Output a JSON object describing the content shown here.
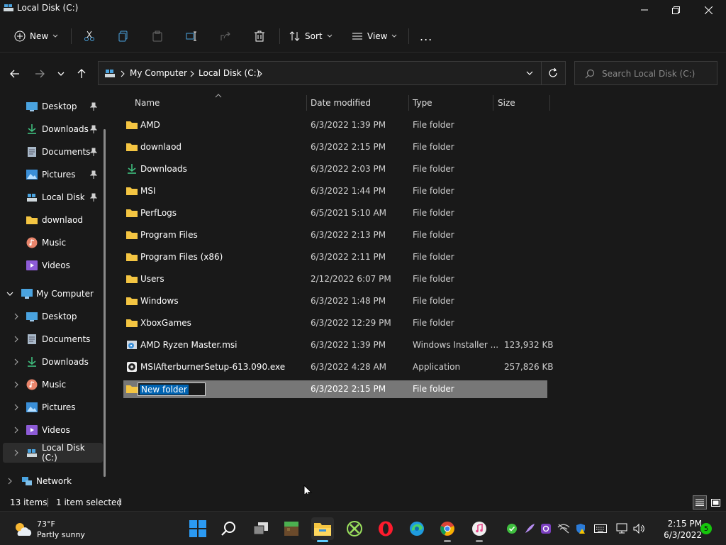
{
  "window": {
    "title": "Local Disk (C:)"
  },
  "toolbar": {
    "new_label": "New",
    "sort_label": "Sort",
    "view_label": "View",
    "more_label": "..."
  },
  "address": {
    "crumbs": [
      "My Computer",
      "Local Disk (C:)"
    ]
  },
  "search": {
    "placeholder": "Search Local Disk (C:)"
  },
  "nav": {
    "quick_access": [
      {
        "label": "Desktop",
        "icon": "desktop-icon",
        "pinned": true
      },
      {
        "label": "Downloads",
        "icon": "download-icon",
        "pinned": true
      },
      {
        "label": "Documents",
        "icon": "document-icon",
        "pinned": true
      },
      {
        "label": "Pictures",
        "icon": "picture-icon",
        "pinned": true
      },
      {
        "label": "Local Disk (C:)",
        "icon": "drive-icon",
        "pinned": true
      },
      {
        "label": "downlaod",
        "icon": "folder-icon",
        "pinned": false
      },
      {
        "label": "Music",
        "icon": "music-icon",
        "pinned": false
      },
      {
        "label": "Videos",
        "icon": "video-icon",
        "pinned": false
      }
    ],
    "this_pc": {
      "label": "My Computer",
      "children": [
        {
          "label": "Desktop",
          "icon": "desktop-icon"
        },
        {
          "label": "Documents",
          "icon": "document-icon"
        },
        {
          "label": "Downloads",
          "icon": "download-icon"
        },
        {
          "label": "Music",
          "icon": "music-icon"
        },
        {
          "label": "Pictures",
          "icon": "picture-icon"
        },
        {
          "label": "Videos",
          "icon": "video-icon"
        },
        {
          "label": "Local Disk (C:)",
          "icon": "drive-icon",
          "selected": true
        }
      ]
    },
    "network": {
      "label": "Network"
    }
  },
  "columns": {
    "name": "Name",
    "date": "Date modified",
    "type": "Type",
    "size": "Size"
  },
  "files": [
    {
      "name": "AMD",
      "date": "6/3/2022 1:39 PM",
      "type": "File folder",
      "size": "",
      "icon": "folder-icon"
    },
    {
      "name": "downlaod",
      "date": "6/3/2022 2:15 PM",
      "type": "File folder",
      "size": "",
      "icon": "folder-icon"
    },
    {
      "name": "Downloads",
      "date": "6/3/2022 2:03 PM",
      "type": "File folder",
      "size": "",
      "icon": "download-icon"
    },
    {
      "name": "MSI",
      "date": "6/3/2022 1:44 PM",
      "type": "File folder",
      "size": "",
      "icon": "folder-icon"
    },
    {
      "name": "PerfLogs",
      "date": "6/5/2021 5:10 AM",
      "type": "File folder",
      "size": "",
      "icon": "folder-icon"
    },
    {
      "name": "Program Files",
      "date": "6/3/2022 2:13 PM",
      "type": "File folder",
      "size": "",
      "icon": "folder-icon"
    },
    {
      "name": "Program Files (x86)",
      "date": "6/3/2022 2:11 PM",
      "type": "File folder",
      "size": "",
      "icon": "folder-icon"
    },
    {
      "name": "Users",
      "date": "2/12/2022 6:07 PM",
      "type": "File folder",
      "size": "",
      "icon": "folder-icon"
    },
    {
      "name": "Windows",
      "date": "6/3/2022 1:48 PM",
      "type": "File folder",
      "size": "",
      "icon": "folder-icon"
    },
    {
      "name": "XboxGames",
      "date": "6/3/2022 12:29 PM",
      "type": "File folder",
      "size": "",
      "icon": "folder-icon"
    },
    {
      "name": "AMD Ryzen Master.msi",
      "date": "6/3/2022 1:39 PM",
      "type": "Windows Installer ...",
      "size": "123,932 KB",
      "icon": "installer-icon"
    },
    {
      "name": "MSIAfterburnerSetup-613.090.exe",
      "date": "6/3/2022 4:28 AM",
      "type": "Application",
      "size": "257,826 KB",
      "icon": "application-icon"
    }
  ],
  "new_folder": {
    "name": "New folder",
    "date": "6/3/2022 2:15 PM",
    "type": "File folder"
  },
  "status": {
    "items": "13 items",
    "selected": "1 item selected"
  },
  "taskbar": {
    "weather_temp": "73°F",
    "weather_desc": "Partly sunny",
    "time": "2:15 PM",
    "date": "6/3/2022",
    "notification_count": "5"
  },
  "colors": {
    "folder": "#f4c542",
    "accent": "#0078d4",
    "selected_row": "#777777"
  }
}
